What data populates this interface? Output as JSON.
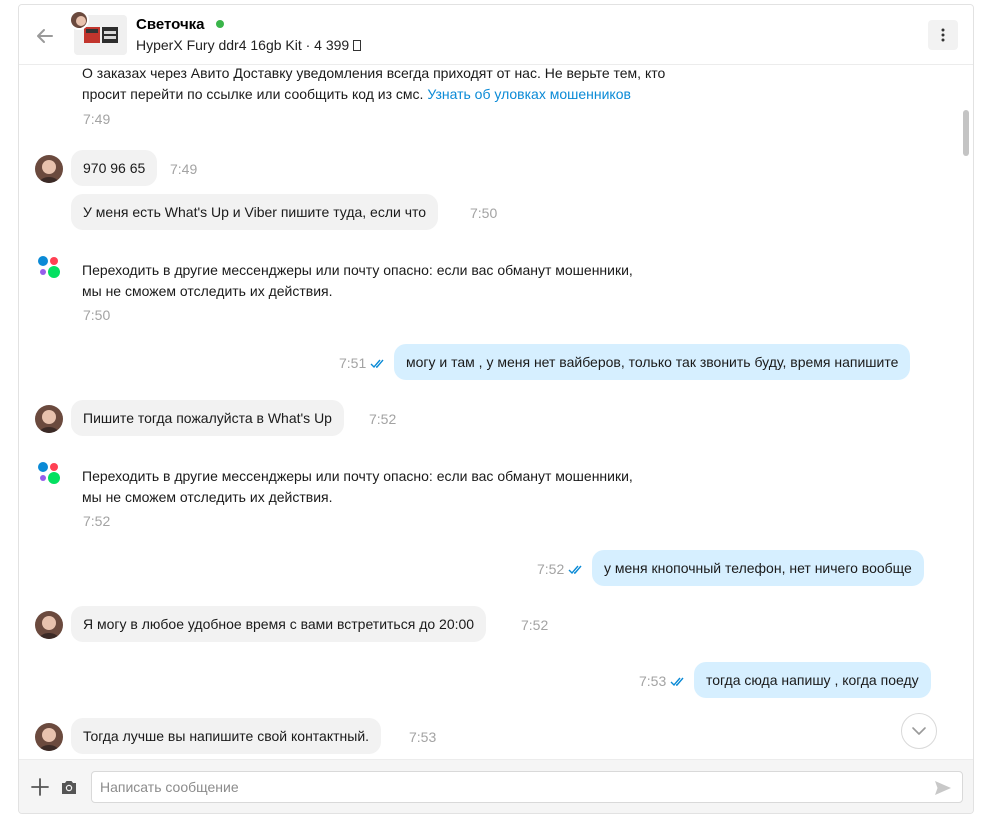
{
  "header": {
    "contact_name": "Светочка",
    "product_line": "HyperX Fury ddr4 16gb Kit · 4 399"
  },
  "messages": [
    {
      "kind": "system",
      "line1": "О заказах через Авито Доставку уведомления всегда приходят от нас. Не верьте тем, кто",
      "line2": "просит перейти по ссылке или сообщить код из смс.",
      "link": "Узнать об уловках мошенников",
      "time": "7:49"
    },
    {
      "kind": "in",
      "text": "970 96 65",
      "time": "7:49"
    },
    {
      "kind": "in",
      "text": "У меня есть What's Up и Viber пишите туда, если что",
      "time": "7:50"
    },
    {
      "kind": "system",
      "line1": "Переходить в другие мессенджеры или почту опасно: если вас обманут мошенники,",
      "line2": "мы не сможем отследить их действия.",
      "time": "7:50"
    },
    {
      "kind": "out",
      "text": "могу и там , у меня нет вайберов, только так звонить буду, время напишите",
      "time": "7:51"
    },
    {
      "kind": "in",
      "text": "Пишите тогда пожалуйста в What's Up",
      "time": "7:52"
    },
    {
      "kind": "system",
      "line1": "Переходить в другие мессенджеры или почту опасно: если вас обманут мошенники,",
      "line2": "мы не сможем отследить их действия.",
      "time": "7:52"
    },
    {
      "kind": "out",
      "text": "у меня кнопочный телефон, нет ничего вообще",
      "time": "7:52"
    },
    {
      "kind": "in",
      "text": "Я могу в любое удобное время с вами встретиться до 20:00",
      "time": "7:52"
    },
    {
      "kind": "out",
      "text": "тогда сюда напишу , когда поеду",
      "time": "7:53"
    },
    {
      "kind": "in",
      "text": "Тогда лучше вы напишите свой контактный.",
      "time": "7:53"
    }
  ],
  "composer": {
    "placeholder": "Написать сообщение"
  },
  "colors": {
    "online": "#3ab54a",
    "link": "#0a8ad6",
    "outgoing_bubble": "#d6efff",
    "incoming_bubble": "#f2f2f2",
    "read_checks": "#0a8ad6"
  },
  "icons": [
    "back-arrow-icon",
    "kebab-menu-icon",
    "plus-icon",
    "camera-icon",
    "send-icon",
    "chevron-down-icon",
    "double-check-icon",
    "avito-logo-icon"
  ]
}
